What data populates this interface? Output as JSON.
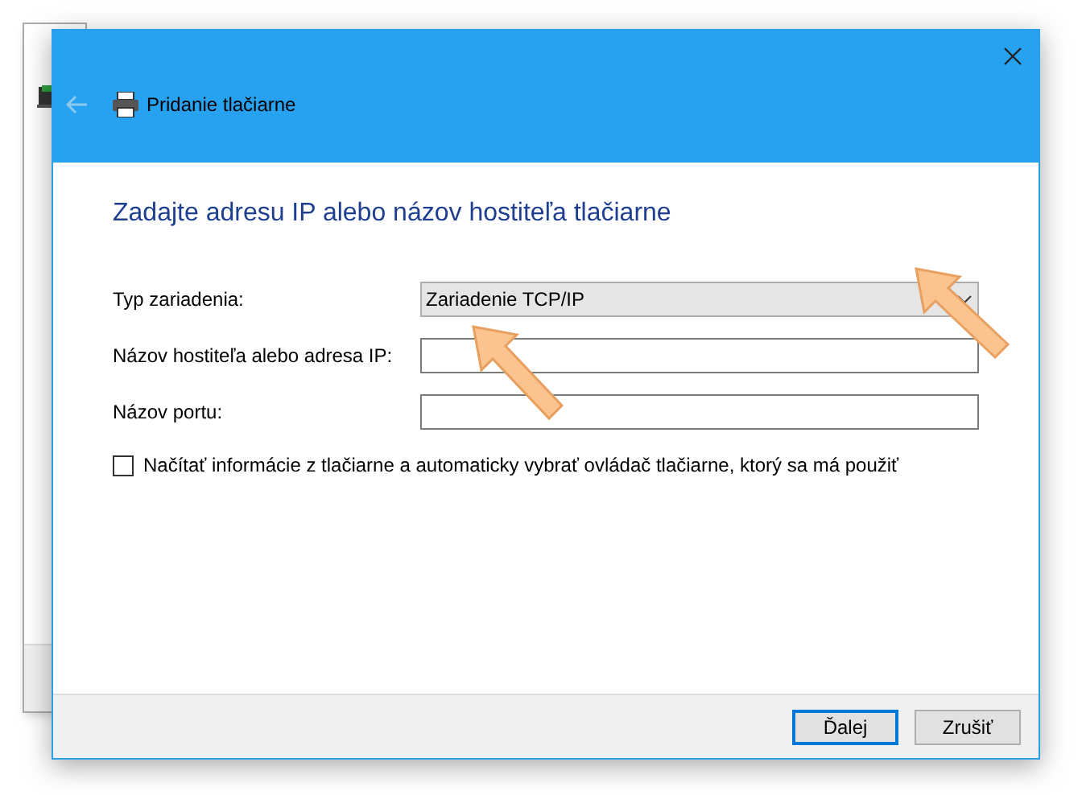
{
  "dialog": {
    "title": "Pridanie tlačiarne",
    "back_disabled": true,
    "heading": "Zadajte adresu IP alebo názov hostiteľa tlačiarne",
    "fields": [
      {
        "kind": "dropdown",
        "label": "Typ zariadenia:",
        "value": "Zariadenie TCP/IP"
      },
      {
        "kind": "text",
        "label": "Názov hostiteľa alebo adresa IP:"
      },
      {
        "kind": "text",
        "label": "Názov portu:"
      }
    ],
    "checkbox": {
      "label": "Načítať informácie z tlačiarne a automaticky vybrať ovládač tlačiarne, ktorý sa má použiť",
      "checked": false
    },
    "buttons": [
      {
        "label": "Ďalej",
        "default": true
      },
      {
        "label": "Zrušiť",
        "default": false
      }
    ]
  }
}
